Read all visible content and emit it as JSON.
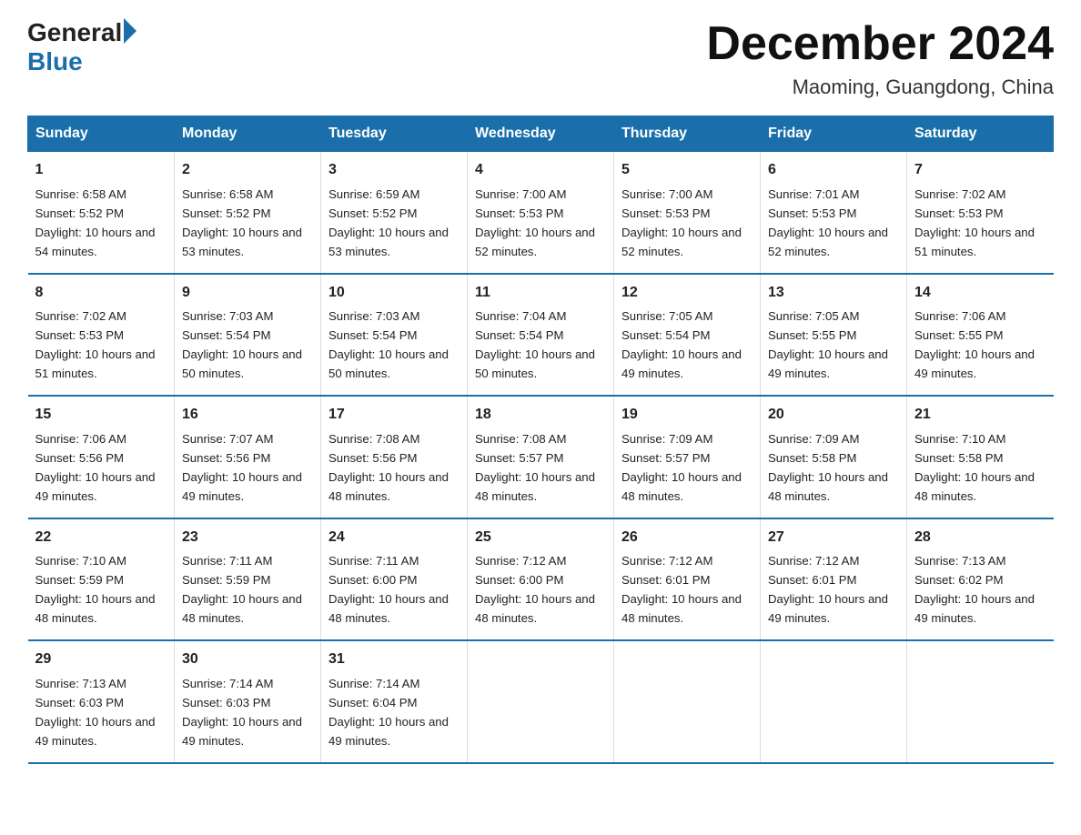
{
  "logo": {
    "text_general": "General",
    "text_blue": "Blue"
  },
  "title": "December 2024",
  "subtitle": "Maoming, Guangdong, China",
  "days_of_week": [
    "Sunday",
    "Monday",
    "Tuesday",
    "Wednesday",
    "Thursday",
    "Friday",
    "Saturday"
  ],
  "weeks": [
    [
      {
        "day": "1",
        "sunrise": "6:58 AM",
        "sunset": "5:52 PM",
        "daylight": "10 hours and 54 minutes."
      },
      {
        "day": "2",
        "sunrise": "6:58 AM",
        "sunset": "5:52 PM",
        "daylight": "10 hours and 53 minutes."
      },
      {
        "day": "3",
        "sunrise": "6:59 AM",
        "sunset": "5:52 PM",
        "daylight": "10 hours and 53 minutes."
      },
      {
        "day": "4",
        "sunrise": "7:00 AM",
        "sunset": "5:53 PM",
        "daylight": "10 hours and 52 minutes."
      },
      {
        "day": "5",
        "sunrise": "7:00 AM",
        "sunset": "5:53 PM",
        "daylight": "10 hours and 52 minutes."
      },
      {
        "day": "6",
        "sunrise": "7:01 AM",
        "sunset": "5:53 PM",
        "daylight": "10 hours and 52 minutes."
      },
      {
        "day": "7",
        "sunrise": "7:02 AM",
        "sunset": "5:53 PM",
        "daylight": "10 hours and 51 minutes."
      }
    ],
    [
      {
        "day": "8",
        "sunrise": "7:02 AM",
        "sunset": "5:53 PM",
        "daylight": "10 hours and 51 minutes."
      },
      {
        "day": "9",
        "sunrise": "7:03 AM",
        "sunset": "5:54 PM",
        "daylight": "10 hours and 50 minutes."
      },
      {
        "day": "10",
        "sunrise": "7:03 AM",
        "sunset": "5:54 PM",
        "daylight": "10 hours and 50 minutes."
      },
      {
        "day": "11",
        "sunrise": "7:04 AM",
        "sunset": "5:54 PM",
        "daylight": "10 hours and 50 minutes."
      },
      {
        "day": "12",
        "sunrise": "7:05 AM",
        "sunset": "5:54 PM",
        "daylight": "10 hours and 49 minutes."
      },
      {
        "day": "13",
        "sunrise": "7:05 AM",
        "sunset": "5:55 PM",
        "daylight": "10 hours and 49 minutes."
      },
      {
        "day": "14",
        "sunrise": "7:06 AM",
        "sunset": "5:55 PM",
        "daylight": "10 hours and 49 minutes."
      }
    ],
    [
      {
        "day": "15",
        "sunrise": "7:06 AM",
        "sunset": "5:56 PM",
        "daylight": "10 hours and 49 minutes."
      },
      {
        "day": "16",
        "sunrise": "7:07 AM",
        "sunset": "5:56 PM",
        "daylight": "10 hours and 49 minutes."
      },
      {
        "day": "17",
        "sunrise": "7:08 AM",
        "sunset": "5:56 PM",
        "daylight": "10 hours and 48 minutes."
      },
      {
        "day": "18",
        "sunrise": "7:08 AM",
        "sunset": "5:57 PM",
        "daylight": "10 hours and 48 minutes."
      },
      {
        "day": "19",
        "sunrise": "7:09 AM",
        "sunset": "5:57 PM",
        "daylight": "10 hours and 48 minutes."
      },
      {
        "day": "20",
        "sunrise": "7:09 AM",
        "sunset": "5:58 PM",
        "daylight": "10 hours and 48 minutes."
      },
      {
        "day": "21",
        "sunrise": "7:10 AM",
        "sunset": "5:58 PM",
        "daylight": "10 hours and 48 minutes."
      }
    ],
    [
      {
        "day": "22",
        "sunrise": "7:10 AM",
        "sunset": "5:59 PM",
        "daylight": "10 hours and 48 minutes."
      },
      {
        "day": "23",
        "sunrise": "7:11 AM",
        "sunset": "5:59 PM",
        "daylight": "10 hours and 48 minutes."
      },
      {
        "day": "24",
        "sunrise": "7:11 AM",
        "sunset": "6:00 PM",
        "daylight": "10 hours and 48 minutes."
      },
      {
        "day": "25",
        "sunrise": "7:12 AM",
        "sunset": "6:00 PM",
        "daylight": "10 hours and 48 minutes."
      },
      {
        "day": "26",
        "sunrise": "7:12 AM",
        "sunset": "6:01 PM",
        "daylight": "10 hours and 48 minutes."
      },
      {
        "day": "27",
        "sunrise": "7:12 AM",
        "sunset": "6:01 PM",
        "daylight": "10 hours and 49 minutes."
      },
      {
        "day": "28",
        "sunrise": "7:13 AM",
        "sunset": "6:02 PM",
        "daylight": "10 hours and 49 minutes."
      }
    ],
    [
      {
        "day": "29",
        "sunrise": "7:13 AM",
        "sunset": "6:03 PM",
        "daylight": "10 hours and 49 minutes."
      },
      {
        "day": "30",
        "sunrise": "7:14 AM",
        "sunset": "6:03 PM",
        "daylight": "10 hours and 49 minutes."
      },
      {
        "day": "31",
        "sunrise": "7:14 AM",
        "sunset": "6:04 PM",
        "daylight": "10 hours and 49 minutes."
      },
      null,
      null,
      null,
      null
    ]
  ]
}
